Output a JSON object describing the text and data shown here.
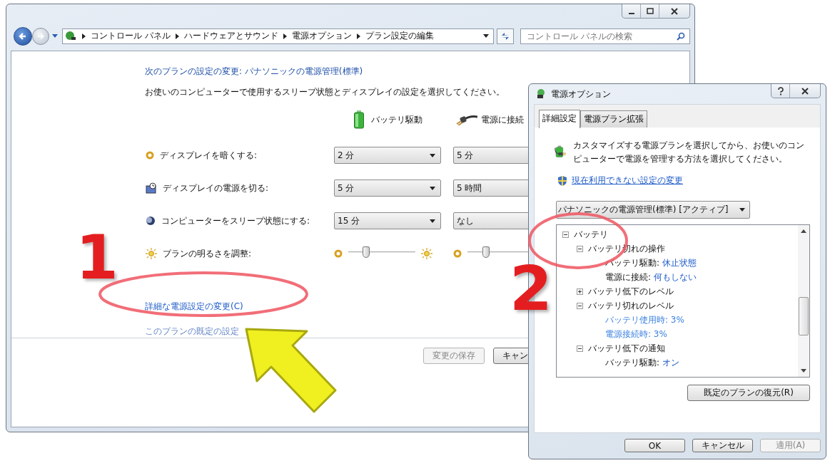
{
  "main_window": {
    "breadcrumbs": [
      "コントロール パネル",
      "ハードウェアとサウンド",
      "電源オプション",
      "プラン設定の編集"
    ],
    "search": {
      "placeholder": "コントロール パネルの検索"
    },
    "heading": "次のプランの設定の変更: パナソニックの電源管理(標準)",
    "description": "お使いのコンピューターで使用するスリープ状態とディスプレイの設定を選択してください。",
    "columns": [
      {
        "kind": "battery",
        "label": "バッテリ駆動"
      },
      {
        "kind": "plug",
        "label": "電源に接続"
      }
    ],
    "settings": [
      {
        "kind": "dropdown",
        "label": "ディスプレイを暗くする:",
        "values": [
          "2 分",
          "5 分"
        ]
      },
      {
        "kind": "dropdown",
        "label": "ディスプレイの電源を切る:",
        "values": [
          "5 分",
          "5 時間"
        ]
      },
      {
        "kind": "dropdown",
        "label": "コンピューターをスリープ状態にする:",
        "values": [
          "15 分",
          "なし"
        ]
      },
      {
        "kind": "slider",
        "label": "プランの明るさを調整:",
        "sliders": [
          {
            "level": 0.27
          },
          {
            "level": 0.28
          }
        ]
      }
    ],
    "links": [
      "詳細な電源設定の変更(C)",
      "このプランの既定の設定"
    ],
    "buttons": [
      {
        "label": "変更の保存",
        "disabled": true
      },
      {
        "label": "キャン",
        "disabled": false
      }
    ]
  },
  "dialog": {
    "title": "電源オプション",
    "tabs": [
      {
        "label": "詳細設定",
        "selected": true
      },
      {
        "label": "電源プラン拡張",
        "selected": false
      }
    ],
    "intro": "カスタマイズする電源プランを選択してから、お使いのコンピューターで電源を管理する方法を選択してください。",
    "admin_link": "現在利用できない設定の変更",
    "plan": "パナソニックの電源管理(標準) [アクティブ]",
    "tree": [
      {
        "label": "バッテリ",
        "expanded": true,
        "children": [
          {
            "label": "バッテリ切れの操作",
            "expanded": true,
            "children": [
              {
                "kind": "pair",
                "label": "バッテリ駆動:",
                "value": "休止状態"
              },
              {
                "kind": "pair",
                "label": "電源に接続:",
                "value": "何もしない"
              }
            ]
          },
          {
            "label": "バッテリ低下のレベル",
            "expanded": false
          },
          {
            "label": "バッテリ切れのレベル",
            "expanded": true,
            "children": [
              {
                "kind": "edit",
                "label": "バッテリ使用時:",
                "value": "3%"
              },
              {
                "kind": "edit",
                "label": "電源接続時:",
                "value": "3%"
              }
            ]
          },
          {
            "label": "バッテリ低下の通知",
            "expanded": true,
            "children": [
              {
                "kind": "pair",
                "label": "バッテリ駆動:",
                "value": "オン"
              }
            ]
          }
        ]
      }
    ],
    "restore_button": "既定のプランの復元(R)",
    "buttons": [
      {
        "label": "OK",
        "disabled": false
      },
      {
        "label": "キャンセル",
        "disabled": false
      },
      {
        "label": "適用(A)",
        "disabled": true
      }
    ]
  },
  "annotations": [
    {
      "label": "1"
    },
    {
      "label": "2"
    }
  ]
}
